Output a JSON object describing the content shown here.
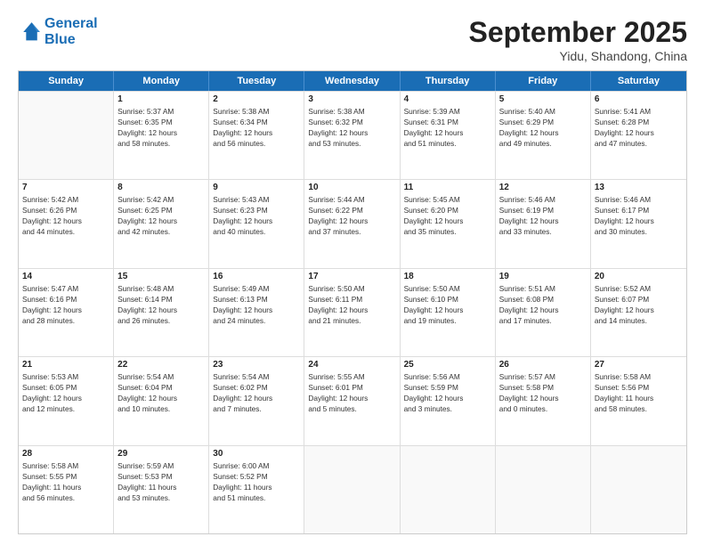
{
  "header": {
    "logo_line1": "General",
    "logo_line2": "Blue",
    "month": "September 2025",
    "location": "Yidu, Shandong, China"
  },
  "weekdays": [
    "Sunday",
    "Monday",
    "Tuesday",
    "Wednesday",
    "Thursday",
    "Friday",
    "Saturday"
  ],
  "rows": [
    [
      {
        "day": "",
        "lines": [],
        "empty": true
      },
      {
        "day": "1",
        "lines": [
          "Sunrise: 5:37 AM",
          "Sunset: 6:35 PM",
          "Daylight: 12 hours",
          "and 58 minutes."
        ]
      },
      {
        "day": "2",
        "lines": [
          "Sunrise: 5:38 AM",
          "Sunset: 6:34 PM",
          "Daylight: 12 hours",
          "and 56 minutes."
        ]
      },
      {
        "day": "3",
        "lines": [
          "Sunrise: 5:38 AM",
          "Sunset: 6:32 PM",
          "Daylight: 12 hours",
          "and 53 minutes."
        ]
      },
      {
        "day": "4",
        "lines": [
          "Sunrise: 5:39 AM",
          "Sunset: 6:31 PM",
          "Daylight: 12 hours",
          "and 51 minutes."
        ]
      },
      {
        "day": "5",
        "lines": [
          "Sunrise: 5:40 AM",
          "Sunset: 6:29 PM",
          "Daylight: 12 hours",
          "and 49 minutes."
        ]
      },
      {
        "day": "6",
        "lines": [
          "Sunrise: 5:41 AM",
          "Sunset: 6:28 PM",
          "Daylight: 12 hours",
          "and 47 minutes."
        ]
      }
    ],
    [
      {
        "day": "7",
        "lines": [
          "Sunrise: 5:42 AM",
          "Sunset: 6:26 PM",
          "Daylight: 12 hours",
          "and 44 minutes."
        ]
      },
      {
        "day": "8",
        "lines": [
          "Sunrise: 5:42 AM",
          "Sunset: 6:25 PM",
          "Daylight: 12 hours",
          "and 42 minutes."
        ]
      },
      {
        "day": "9",
        "lines": [
          "Sunrise: 5:43 AM",
          "Sunset: 6:23 PM",
          "Daylight: 12 hours",
          "and 40 minutes."
        ]
      },
      {
        "day": "10",
        "lines": [
          "Sunrise: 5:44 AM",
          "Sunset: 6:22 PM",
          "Daylight: 12 hours",
          "and 37 minutes."
        ]
      },
      {
        "day": "11",
        "lines": [
          "Sunrise: 5:45 AM",
          "Sunset: 6:20 PM",
          "Daylight: 12 hours",
          "and 35 minutes."
        ]
      },
      {
        "day": "12",
        "lines": [
          "Sunrise: 5:46 AM",
          "Sunset: 6:19 PM",
          "Daylight: 12 hours",
          "and 33 minutes."
        ]
      },
      {
        "day": "13",
        "lines": [
          "Sunrise: 5:46 AM",
          "Sunset: 6:17 PM",
          "Daylight: 12 hours",
          "and 30 minutes."
        ]
      }
    ],
    [
      {
        "day": "14",
        "lines": [
          "Sunrise: 5:47 AM",
          "Sunset: 6:16 PM",
          "Daylight: 12 hours",
          "and 28 minutes."
        ]
      },
      {
        "day": "15",
        "lines": [
          "Sunrise: 5:48 AM",
          "Sunset: 6:14 PM",
          "Daylight: 12 hours",
          "and 26 minutes."
        ]
      },
      {
        "day": "16",
        "lines": [
          "Sunrise: 5:49 AM",
          "Sunset: 6:13 PM",
          "Daylight: 12 hours",
          "and 24 minutes."
        ]
      },
      {
        "day": "17",
        "lines": [
          "Sunrise: 5:50 AM",
          "Sunset: 6:11 PM",
          "Daylight: 12 hours",
          "and 21 minutes."
        ]
      },
      {
        "day": "18",
        "lines": [
          "Sunrise: 5:50 AM",
          "Sunset: 6:10 PM",
          "Daylight: 12 hours",
          "and 19 minutes."
        ]
      },
      {
        "day": "19",
        "lines": [
          "Sunrise: 5:51 AM",
          "Sunset: 6:08 PM",
          "Daylight: 12 hours",
          "and 17 minutes."
        ]
      },
      {
        "day": "20",
        "lines": [
          "Sunrise: 5:52 AM",
          "Sunset: 6:07 PM",
          "Daylight: 12 hours",
          "and 14 minutes."
        ]
      }
    ],
    [
      {
        "day": "21",
        "lines": [
          "Sunrise: 5:53 AM",
          "Sunset: 6:05 PM",
          "Daylight: 12 hours",
          "and 12 minutes."
        ]
      },
      {
        "day": "22",
        "lines": [
          "Sunrise: 5:54 AM",
          "Sunset: 6:04 PM",
          "Daylight: 12 hours",
          "and 10 minutes."
        ]
      },
      {
        "day": "23",
        "lines": [
          "Sunrise: 5:54 AM",
          "Sunset: 6:02 PM",
          "Daylight: 12 hours",
          "and 7 minutes."
        ]
      },
      {
        "day": "24",
        "lines": [
          "Sunrise: 5:55 AM",
          "Sunset: 6:01 PM",
          "Daylight: 12 hours",
          "and 5 minutes."
        ]
      },
      {
        "day": "25",
        "lines": [
          "Sunrise: 5:56 AM",
          "Sunset: 5:59 PM",
          "Daylight: 12 hours",
          "and 3 minutes."
        ]
      },
      {
        "day": "26",
        "lines": [
          "Sunrise: 5:57 AM",
          "Sunset: 5:58 PM",
          "Daylight: 12 hours",
          "and 0 minutes."
        ]
      },
      {
        "day": "27",
        "lines": [
          "Sunrise: 5:58 AM",
          "Sunset: 5:56 PM",
          "Daylight: 11 hours",
          "and 58 minutes."
        ]
      }
    ],
    [
      {
        "day": "28",
        "lines": [
          "Sunrise: 5:58 AM",
          "Sunset: 5:55 PM",
          "Daylight: 11 hours",
          "and 56 minutes."
        ]
      },
      {
        "day": "29",
        "lines": [
          "Sunrise: 5:59 AM",
          "Sunset: 5:53 PM",
          "Daylight: 11 hours",
          "and 53 minutes."
        ]
      },
      {
        "day": "30",
        "lines": [
          "Sunrise: 6:00 AM",
          "Sunset: 5:52 PM",
          "Daylight: 11 hours",
          "and 51 minutes."
        ]
      },
      {
        "day": "",
        "lines": [],
        "empty": true
      },
      {
        "day": "",
        "lines": [],
        "empty": true
      },
      {
        "day": "",
        "lines": [],
        "empty": true
      },
      {
        "day": "",
        "lines": [],
        "empty": true
      }
    ]
  ]
}
